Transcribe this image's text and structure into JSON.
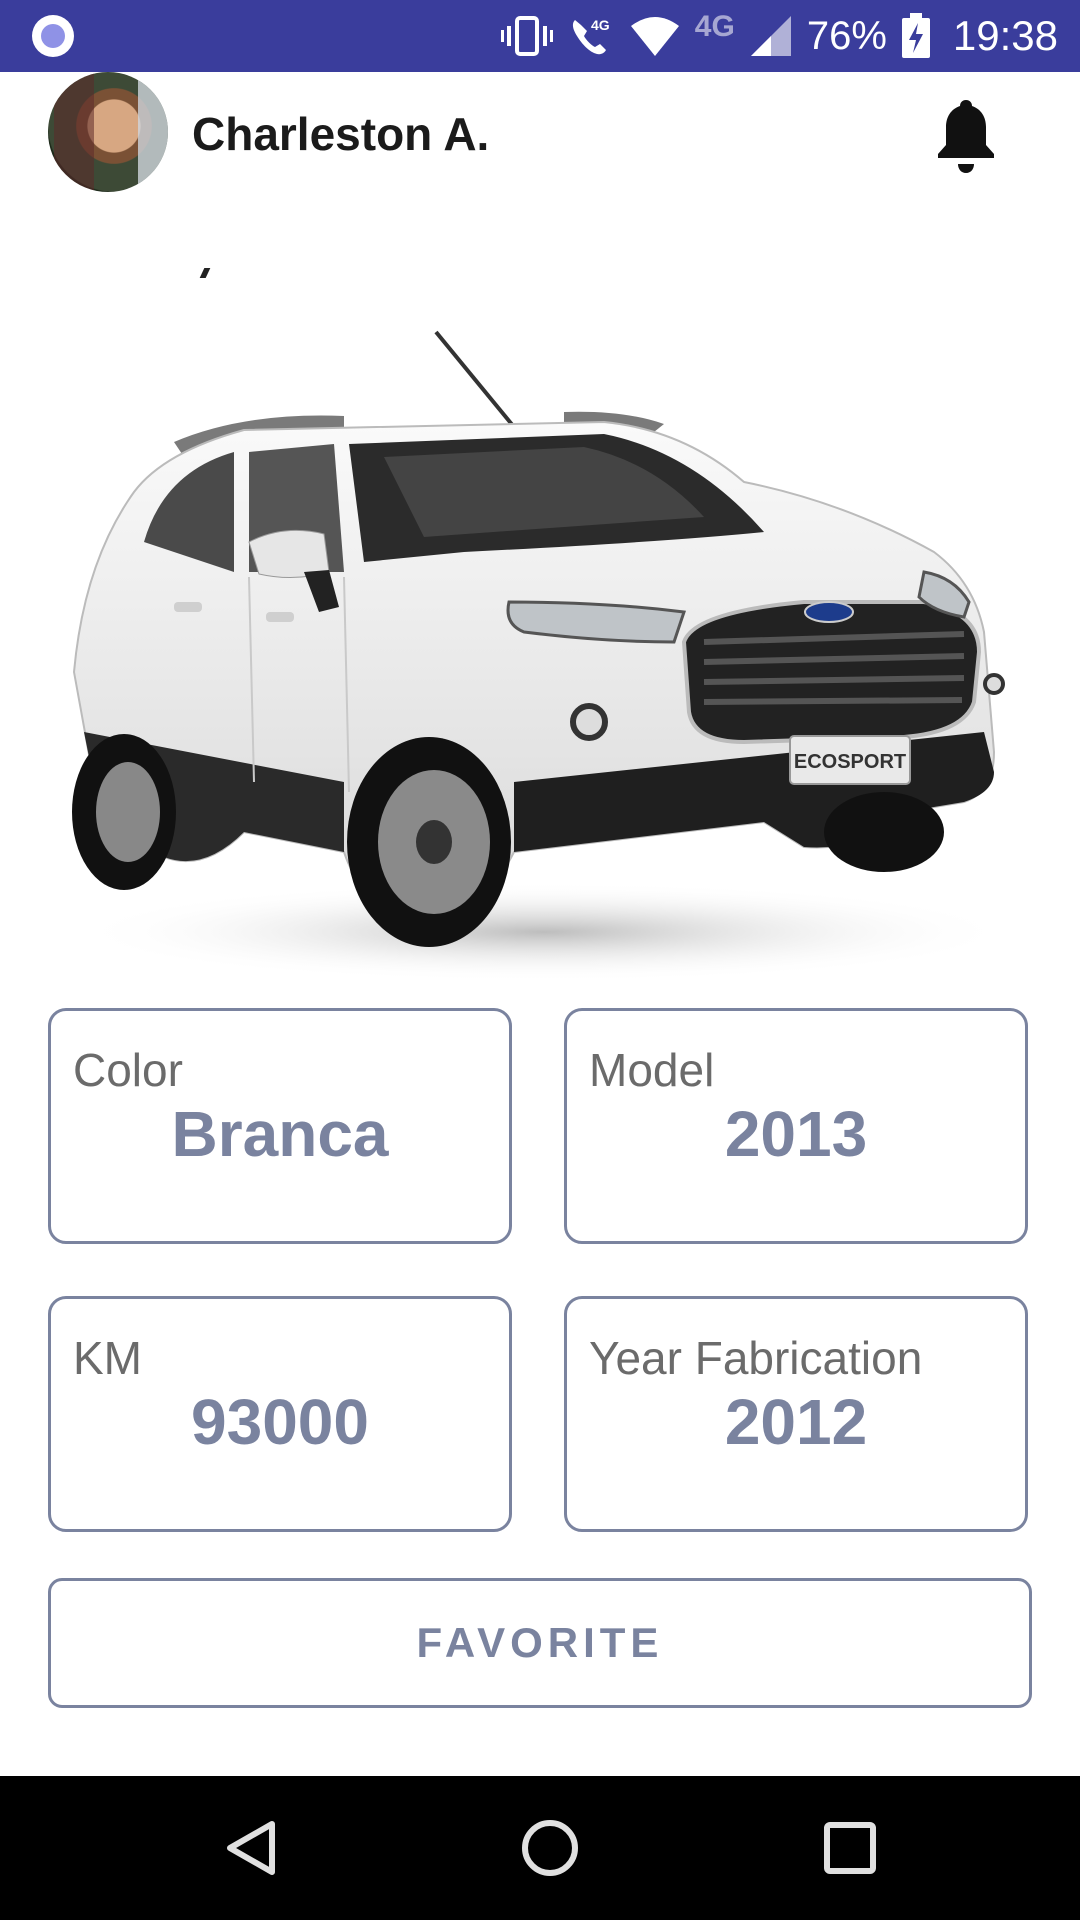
{
  "status_bar": {
    "battery_percent": "76%",
    "time": "19:38",
    "network_label": "4G",
    "call_label": "4G"
  },
  "header": {
    "user_name": "Charleston A."
  },
  "car": {
    "badge_text": "ECOSPORT"
  },
  "details": {
    "color": {
      "label": "Color",
      "value": "Branca"
    },
    "model": {
      "label": "Model",
      "value": "2013"
    },
    "km": {
      "label": "KM",
      "value": "93000"
    },
    "year_fabrication": {
      "label": "Year Fabrication",
      "value": "2012"
    }
  },
  "actions": {
    "favorite_label": "FAVORITE"
  },
  "colors": {
    "status_bar": "#3a3d9c",
    "accent": "#7a839f"
  }
}
